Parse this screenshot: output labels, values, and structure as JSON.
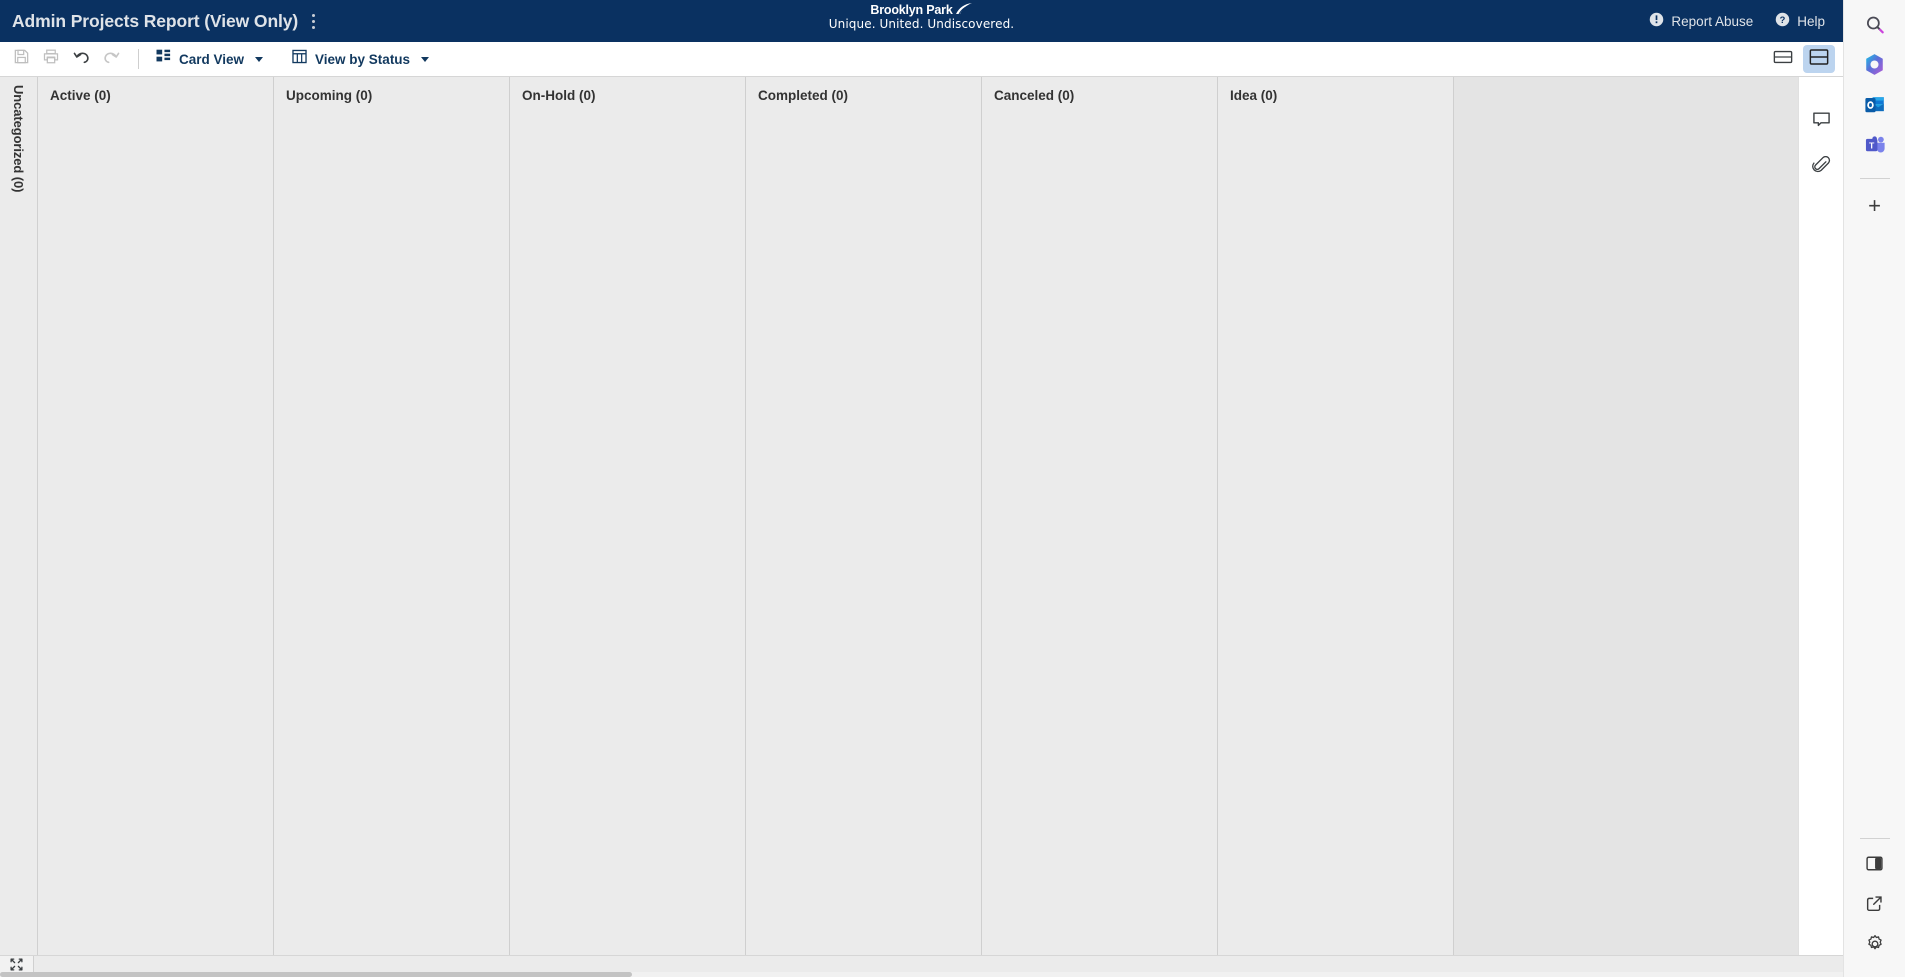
{
  "colors": {
    "header_navy": "#0a3161",
    "board_bg": "#e4e4e4",
    "column_bg": "#ebebeb",
    "toolbar_text": "#12395f",
    "toggle_active": "#bcd4ef"
  },
  "titlebar": {
    "app_title": "Admin Projects Report (View Only)",
    "kebab_icon": "kebab-menu-icon",
    "brand": {
      "name": "Brooklyn Park",
      "tagline": "Unique. United. Undiscovered.",
      "swoosh_icon": "brand-swoosh-icon"
    },
    "links": [
      {
        "label": "Report Abuse",
        "icon": "alert-circle-icon"
      },
      {
        "label": "Help",
        "icon": "help-circle-icon"
      }
    ]
  },
  "toolbar": {
    "buttons": [
      {
        "name": "save-button",
        "icon": "save-icon",
        "enabled": false
      },
      {
        "name": "print-button",
        "icon": "print-icon",
        "enabled": false
      },
      {
        "name": "undo-button",
        "icon": "undo-icon",
        "enabled": true
      },
      {
        "name": "redo-button",
        "icon": "redo-icon",
        "enabled": false
      }
    ],
    "view_mode": {
      "label": "Card View",
      "icon": "card-view-icon"
    },
    "group_by": {
      "label": "View by Status",
      "icon": "table-view-icon"
    },
    "layout_toggles": [
      {
        "name": "single-pane-layout-toggle",
        "icon": "single-pane-icon",
        "active": false
      },
      {
        "name": "split-pane-layout-toggle",
        "icon": "split-pane-icon",
        "active": true
      }
    ]
  },
  "board": {
    "swimlane": {
      "label": "Uncategorized (0)"
    },
    "columns": [
      {
        "label": "Active (0)"
      },
      {
        "label": "Upcoming (0)"
      },
      {
        "label": "On-Hold (0)"
      },
      {
        "label": "Completed (0)"
      },
      {
        "label": "Canceled (0)"
      },
      {
        "label": "Idea (0)"
      }
    ]
  },
  "rail": {
    "buttons": [
      {
        "name": "comments-button",
        "icon": "comment-icon"
      },
      {
        "name": "attachments-button",
        "icon": "paperclip-icon"
      }
    ]
  },
  "bottombar": {
    "expand": {
      "name": "expand-fullscreen-button",
      "icon": "expand-icon"
    }
  },
  "edgebar": {
    "top": [
      {
        "name": "edge-search-button",
        "icon": "search-icon"
      },
      {
        "name": "edge-copilot-button",
        "icon": "copilot-icon"
      },
      {
        "name": "edge-outlook-button",
        "icon": "outlook-icon"
      },
      {
        "name": "edge-teams-button",
        "icon": "teams-icon"
      }
    ],
    "add": {
      "name": "edge-add-button",
      "icon": "plus-icon",
      "glyph": "+"
    },
    "bottom": [
      {
        "name": "edge-split-screen-button",
        "icon": "split-screen-icon"
      },
      {
        "name": "edge-open-new-window-button",
        "icon": "open-external-icon"
      },
      {
        "name": "edge-settings-button",
        "icon": "gear-icon"
      }
    ]
  }
}
